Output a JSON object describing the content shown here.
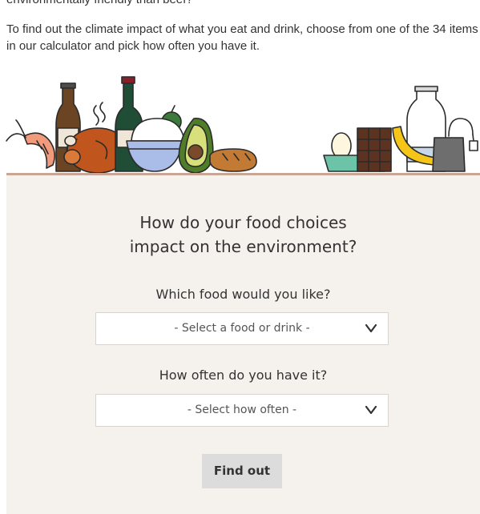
{
  "article": {
    "cut_text": "environmentally friendly than beef?",
    "intro": "To find out the climate impact of what you eat and drink, choose from one of the 34 items in our calculator and pick how often you have it."
  },
  "calculator": {
    "title_line1": "How do your food choices",
    "title_line2": "impact on the environment?",
    "food_question": "Which food would you like?",
    "food_select_value": "- Select a food or drink -",
    "frequency_question": "How often do you have it?",
    "frequency_select_value": "- Select how often -",
    "submit_label": "Find out"
  },
  "colors": {
    "panel_bg": "#f5f1ec",
    "divider": "#c9a596",
    "button_bg": "#dcdcdc"
  },
  "icons": [
    "shrimp-icon",
    "beer-bottle-icon",
    "roast-chicken-icon",
    "wine-bottle-icon",
    "rice-bowl-icon",
    "apples-icon",
    "avocado-icon",
    "bread-icon",
    "eggs-icon",
    "chocolate-icon",
    "banana-icon",
    "milk-bottle-icon",
    "tea-icon",
    "chevron-down-icon"
  ]
}
